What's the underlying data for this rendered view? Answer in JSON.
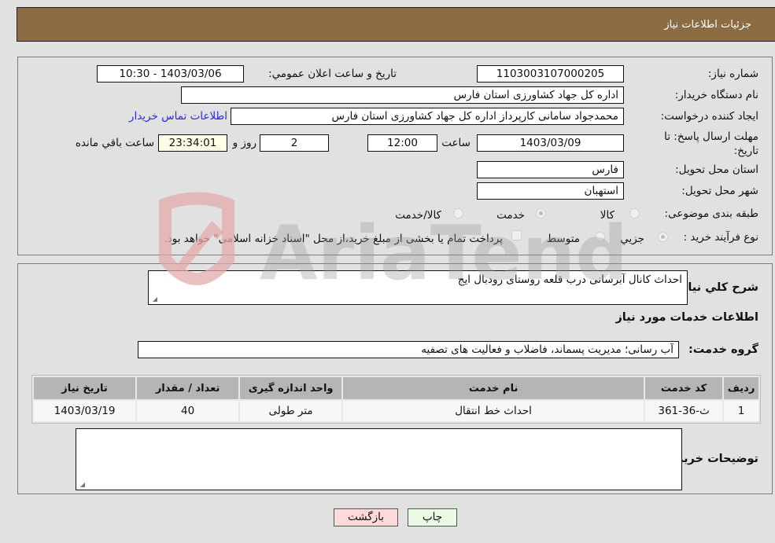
{
  "header": {
    "title": "جزئیات اطلاعات نیاز"
  },
  "details": {
    "need_number": {
      "label": "شماره نیاز:",
      "value": "1103003107000205"
    },
    "announce_datetime": {
      "label": "تاریخ و ساعت اعلان عمومي:",
      "value": "1403/03/06 - 10:30"
    },
    "buyer_org": {
      "label": "نام دستگاه خريدار:",
      "value": "اداره کل جهاد کشاورزی استان فارس"
    },
    "requester": {
      "label": "ايجاد کننده درخواست:",
      "value": "محمدجواد سامانی کارپرداز اداره کل جهاد کشاورزی استان فارس"
    },
    "buyer_contact_link": "اطلاعات تماس خريدار",
    "deadline": {
      "label": "مهلت ارسال پاسخ: تا تاریخ:",
      "date": "1403/03/09",
      "time_label": "ساعت",
      "time": "12:00",
      "days": "2",
      "days_label": "روز و",
      "remaining": "23:34:01",
      "remaining_label": "ساعت باقي مانده"
    },
    "province": {
      "label": "استان محل تحويل:",
      "value": "فارس"
    },
    "city": {
      "label": "شهر محل تحويل:",
      "value": "استهبان"
    },
    "category": {
      "label": "طبقه بندی موضوعی:",
      "options": [
        "کالا",
        "خدمت",
        "کالا/خدمت"
      ],
      "selected": "خدمت"
    },
    "process_type": {
      "label": "نوع فرآيند خريد :",
      "options": [
        "جزيي",
        "متوسط"
      ],
      "selected": "جزيي",
      "treasury_note": "پرداخت تمام یا بخشی از مبلغ خرید،از محل \"اسناد خزانه اسلامی\" خواهد بود.",
      "treasury_checked": false
    }
  },
  "description": {
    "label": "شرح کلي نياز:",
    "value": "احداث کانال آبرسانی درب قلعه روستای رودبال ایج"
  },
  "services": {
    "section_title": "اطلاعات خدمات مورد نياز",
    "group_label": "گروه خدمت:",
    "group_value": "آب رسانی؛ مدیریت پسماند، فاضلاب و فعالیت های تصفیه",
    "columns": [
      "رديف",
      "کد خدمت",
      "نام خدمت",
      "واحد اندازه گيری",
      "تعداد / مقدار",
      "تاريخ نياز"
    ],
    "rows": [
      [
        "1",
        "ث-36-361",
        "احداث خط انتقال",
        "متر طولی",
        "40",
        "1403/03/19"
      ]
    ]
  },
  "buyer_notes": {
    "label": "توضيحات خريدار:",
    "value": ""
  },
  "buttons": {
    "print": "چاپ",
    "back": "بازگشت"
  },
  "watermark": {
    "text": "AriaTender.neT"
  },
  "colors": {
    "header": "#8c6c42",
    "link": "#2b2bdc",
    "back_btn": "#fdd9d9",
    "print_btn": "#e9fbe4"
  }
}
